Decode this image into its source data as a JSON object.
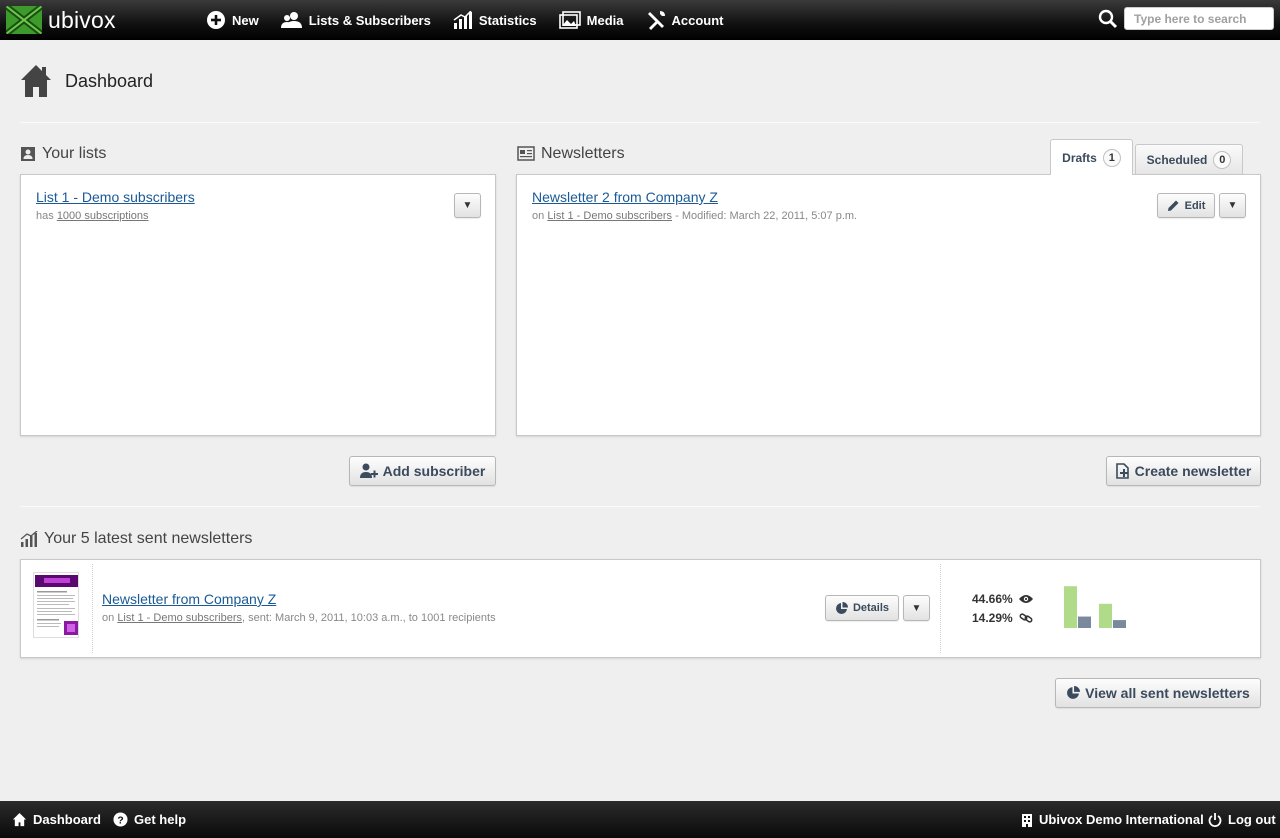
{
  "app": {
    "logo_text": "ubivox",
    "brand_color": "#3d9b2c"
  },
  "nav": [
    {
      "label": "New",
      "icon": "plus-circle-icon"
    },
    {
      "label": "Lists & Subscribers",
      "icon": "users-icon"
    },
    {
      "label": "Statistics",
      "icon": "bar-chart-icon"
    },
    {
      "label": "Media",
      "icon": "images-icon"
    },
    {
      "label": "Account",
      "icon": "tools-icon"
    }
  ],
  "search": {
    "placeholder": "Type here to search"
  },
  "page": {
    "title": "Dashboard"
  },
  "lists": {
    "title": "Your lists",
    "items": [
      {
        "name": "List 1 - Demo subscribers",
        "prefix": "has",
        "subscriptions": "1000 subscriptions"
      }
    ],
    "add_button": "Add subscriber"
  },
  "newsletters": {
    "title": "Newsletters",
    "tabs": [
      {
        "label": "Drafts",
        "count": "1",
        "active": true
      },
      {
        "label": "Scheduled",
        "count": "0",
        "active": false
      }
    ],
    "items": [
      {
        "name": "Newsletter 2 from Company Z",
        "prefix": "on",
        "list": "List 1 - Demo subscribers",
        "modified": "- Modified: March 22, 2011, 5:07 p.m."
      }
    ],
    "edit_button": "Edit",
    "create_button": "Create newsletter"
  },
  "sent": {
    "title": "Your 5 latest sent newsletters",
    "items": [
      {
        "name": "Newsletter from Company Z",
        "prefix": "on",
        "list": "List 1 - Demo subscribers",
        "meta": ", sent: March 9, 2011, 10:03 a.m., to 1001 recipients",
        "details_button": "Details",
        "open_rate": "44.66%",
        "click_rate": "14.29%",
        "mini_chart": {
          "bars": [
            0.95,
            0.26,
            0.55,
            0.18
          ],
          "colors": [
            "#b0dc8a",
            "#7a8a9c",
            "#b0dc8a",
            "#7a8a9c"
          ]
        }
      }
    ],
    "view_all_button": "View all sent newsletters"
  },
  "footer": {
    "dashboard": "Dashboard",
    "help": "Get help",
    "org": "Ubivox Demo International",
    "logout": "Log out"
  }
}
